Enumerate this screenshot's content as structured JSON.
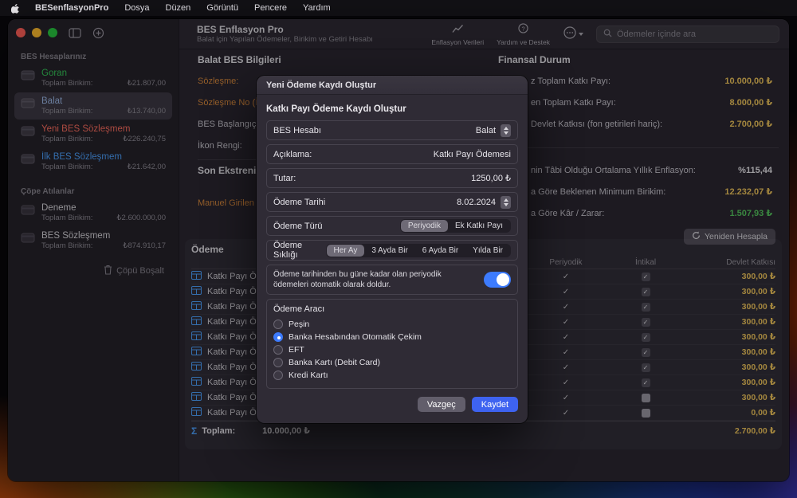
{
  "colors": {
    "accent_blue": "#3d7bfd",
    "save_blue": "#3e63f0",
    "value_yellow": "#f0c65c",
    "profit_green": "#56c75f",
    "link_orange": "#d98a3d"
  },
  "menu": {
    "app_name": "BESenflasyonPro",
    "items": [
      "Dosya",
      "Düzen",
      "Görüntü",
      "Pencere",
      "Yardım"
    ]
  },
  "tb": {
    "title": "BES Enflasyon Pro",
    "subtitle": "Balat için Yapılan Ödemeler, Birikim ve Getiri Hesabı",
    "items": [
      {
        "label": "Enflasyon Verileri"
      },
      {
        "label": "Yardım ve Destek"
      }
    ],
    "search_placeholder": "Ödemeler içinde ara"
  },
  "sb": {
    "accounts_header": "BES Hesaplarınız",
    "accounts": [
      {
        "name": "Goran",
        "sub": "Toplam Birikim:",
        "value": "₺21.807,00",
        "color": "#35c759"
      },
      {
        "name": "Balat",
        "sub": "Toplam Birikim:",
        "value": "₺13.740,00",
        "color": "#9db9e8"
      },
      {
        "name": "Yeni BES Sözleşmem",
        "sub": "Toplam Birikim:",
        "value": "₺226.240,75",
        "color": "#ff6f61"
      },
      {
        "name": "İlk BES Sözleşmem",
        "sub": "Toplam Birikim:",
        "value": "₺21.642,00",
        "color": "#4da2ff"
      }
    ],
    "trash_header": "Çöpe Atılanlar",
    "trashed": [
      {
        "name": "Deneme",
        "sub": "Toplam Birikim:",
        "value": "₺2.600.000,00",
        "color": "#d9d7dd"
      },
      {
        "name": "BES Sözleşmem",
        "sub": "Toplam Birikim:",
        "value": "₺874.910,17",
        "color": "#d9d7dd"
      }
    ],
    "empty_trash": "Çöpü Boşalt"
  },
  "info": {
    "title": "Balat BES Bilgileri",
    "rows": [
      "Sözleşme:",
      "Sözleşme No (İst",
      "BES Başlangıç Tar",
      "İkon Rengi:"
    ],
    "stmt_title": "Son Ekstrenizdek",
    "stmt_link": "Manuel Girilen T"
  },
  "fin": {
    "title": "Finansal Durum",
    "rows": [
      {
        "label": "z Toplam Katkı Payı:",
        "value": "10.000,00 ₺",
        "color": "#f0c65c"
      },
      {
        "label": "en Toplam Katkı Payı:",
        "value": "8.000,00 ₺",
        "color": "#f0c65c"
      },
      {
        "label": "Devlet Katkısı (fon getirileri hariç):",
        "value": "2.700,00 ₺",
        "color": "#f0c65c"
      },
      {
        "label": "nin Tâbi Olduğu Ortalama Yıllık Enflasyon:",
        "value": "%115,44",
        "color": "#e9e7ec"
      },
      {
        "label": "a Göre Beklenen Minimum Birikim:",
        "value": "12.232,07 ₺",
        "color": "#f0c65c"
      },
      {
        "label": "a Göre Kâr / Zarar:",
        "value": "1.507,93 ₺",
        "color": "#56c75f"
      }
    ],
    "recalc": "Yeniden Hesapla"
  },
  "pay": {
    "section_title": "Ödeme",
    "col_periodic": "Periyodik",
    "col_transfer": "İntikal",
    "col_gov": "Devlet Katkısı",
    "rows": [
      {
        "name": "Katkı Payı Ödemesi",
        "gov": "300,00 ₺",
        "transfer_checked": true
      },
      {
        "name": "Katkı Payı Ödemesi",
        "gov": "300,00 ₺",
        "transfer_checked": true
      },
      {
        "name": "Katkı Payı Ödemesi",
        "gov": "300,00 ₺",
        "transfer_checked": true
      },
      {
        "name": "Katkı Payı Ödemesi",
        "gov": "300,00 ₺",
        "transfer_checked": true
      },
      {
        "name": "Katkı Payı Ödemesi",
        "gov": "300,00 ₺",
        "transfer_checked": true
      },
      {
        "name": "Katkı Payı Ödemesi",
        "gov": "300,00 ₺",
        "transfer_checked": true
      },
      {
        "name": "Katkı Payı Ödemesi",
        "gov": "300,00 ₺",
        "transfer_checked": true
      },
      {
        "name": "Katkı Payı Ödemesi",
        "gov": "300,00 ₺",
        "transfer_checked": true
      },
      {
        "name": "Katkı Payı Ödemesi",
        "gov": "300,00 ₺",
        "transfer_checked": false
      },
      {
        "name": "Katkı Payı Ödemesi",
        "gov": "0,00 ₺",
        "transfer_checked": false
      }
    ],
    "total_label": "Toplam:",
    "total_value": "10.000,00 ₺",
    "total_gov": "2.700,00 ₺"
  },
  "modal": {
    "title": "Yeni Ödeme Kaydı Oluştur",
    "heading": "Katkı Payı Ödeme Kaydı Oluştur",
    "account_label": "BES Hesabı",
    "account_value": "Balat",
    "description_label": "Açıklama:",
    "description_value": "Katkı Payı Ödemesi",
    "amount_label": "Tutar:",
    "amount_value": "1250,00 ₺",
    "date_label": "Ödeme Tarihi",
    "date_value": "8.02.2024",
    "type_label": "Ödeme Türü",
    "type_options": [
      "Periyodik",
      "Ek Katkı Payı"
    ],
    "freq_label": "Ödeme Sıklığı",
    "freq_options": [
      "Her Ay",
      "3 Ayda Bir",
      "6 Ayda Bir",
      "Yılda Bir"
    ],
    "autofill_text": "Ödeme tarihinden bu güne kadar olan periyodik ödemeleri otomatik olarak doldur.",
    "method_label": "Ödeme Aracı",
    "methods": [
      "Peşin",
      "Banka Hesabından Otomatik Çekim",
      "EFT",
      "Banka Kartı (Debit Card)",
      "Kredi Kartı"
    ],
    "cancel": "Vazgeç",
    "save": "Kaydet"
  }
}
